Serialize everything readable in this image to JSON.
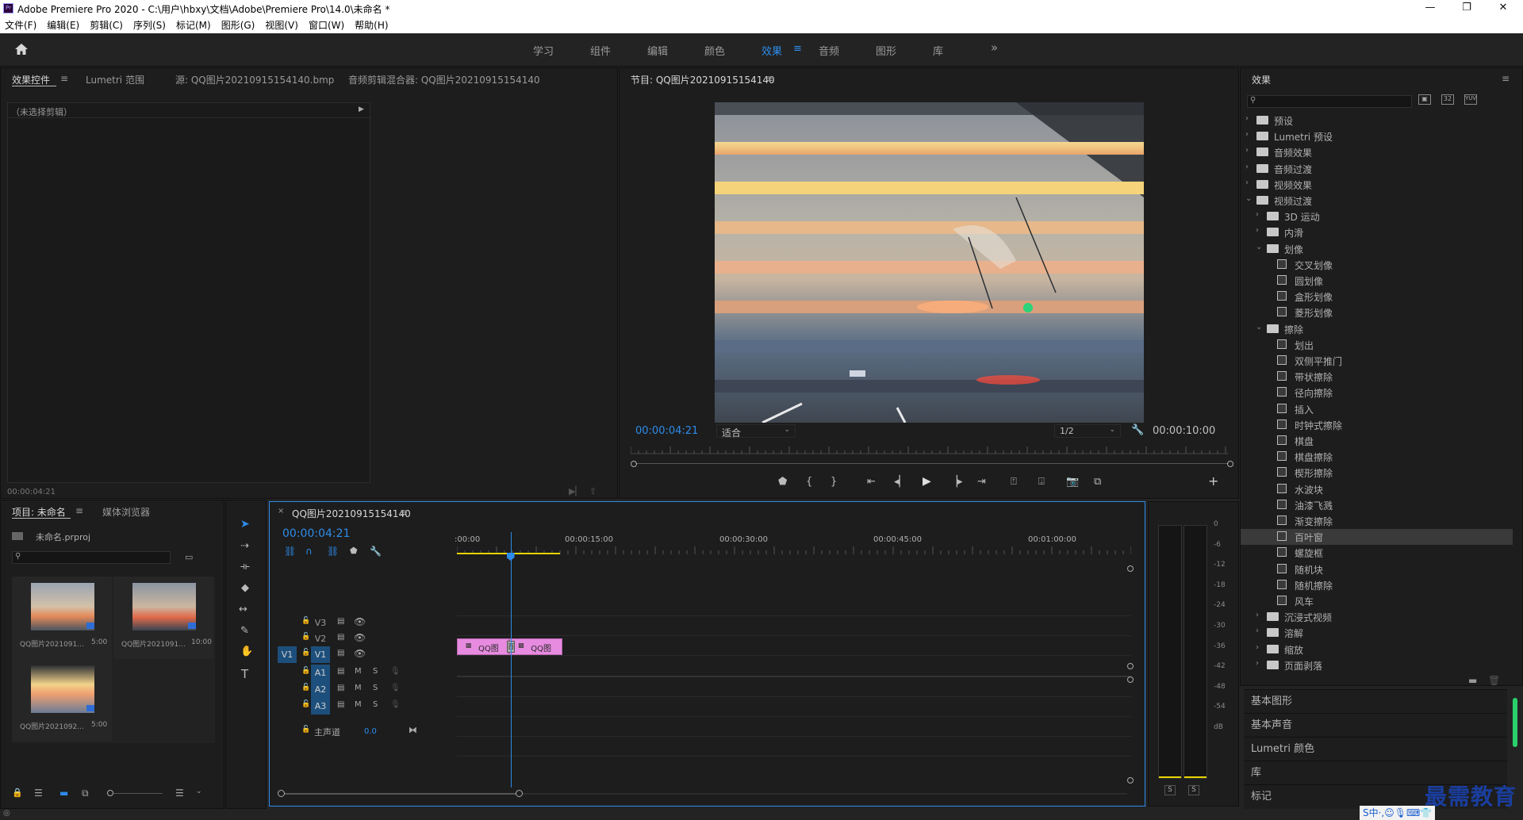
{
  "app": {
    "title": "Adobe Premiere Pro 2020 - C:\\用户\\hbxy\\文档\\Adobe\\Premiere Pro\\14.0\\未命名 *",
    "window_controls": [
      "—",
      "❐",
      "✕"
    ]
  },
  "menu": [
    "文件(F)",
    "编辑(E)",
    "剪辑(C)",
    "序列(S)",
    "标记(M)",
    "图形(G)",
    "视图(V)",
    "窗口(W)",
    "帮助(H)"
  ],
  "workspaces": [
    "学习",
    "组件",
    "编辑",
    "颜色",
    "效果",
    "音频",
    "图形",
    "库"
  ],
  "workspace_more": "»",
  "workspace_menu_icon": "≡",
  "source_panel": {
    "tabs": [
      "效果控件",
      "Lumetri 范围",
      "源: QQ图片20210915154140.bmp",
      "音频剪辑混合器: QQ图片20210915154140"
    ],
    "menu_icon": "≡",
    "no_clip": "（未选择剪辑）",
    "timecode": "00:00:04:21"
  },
  "program": {
    "title": "节目: QQ图片20210915154140",
    "menu_icon": "≡",
    "timecode": "00:00:04:21",
    "fit": "适合",
    "resolution": "1/2",
    "duration": "00:00:10:00",
    "playhead": 0.486
  },
  "effects_panel": {
    "title": "效果",
    "menu_icon": "≡",
    "search_placeholder": "",
    "items": [
      {
        "label": "预设",
        "level": 0,
        "type": "preset",
        "state": "collapsed"
      },
      {
        "label": "Lumetri 预设",
        "level": 0,
        "type": "preset",
        "state": "collapsed"
      },
      {
        "label": "音频效果",
        "level": 0,
        "type": "folder",
        "state": "collapsed"
      },
      {
        "label": "音频过渡",
        "level": 0,
        "type": "folder",
        "state": "collapsed"
      },
      {
        "label": "视频效果",
        "level": 0,
        "type": "folder",
        "state": "collapsed"
      },
      {
        "label": "视频过渡",
        "level": 0,
        "type": "folder",
        "state": "expanded"
      },
      {
        "label": "3D 运动",
        "level": 1,
        "type": "folder",
        "state": "collapsed"
      },
      {
        "label": "内滑",
        "level": 1,
        "type": "folder",
        "state": "collapsed"
      },
      {
        "label": "划像",
        "level": 1,
        "type": "folder",
        "state": "expanded"
      },
      {
        "label": "交叉划像",
        "level": 2,
        "type": "effect"
      },
      {
        "label": "圆划像",
        "level": 2,
        "type": "effect"
      },
      {
        "label": "盒形划像",
        "level": 2,
        "type": "effect"
      },
      {
        "label": "菱形划像",
        "level": 2,
        "type": "effect"
      },
      {
        "label": "擦除",
        "level": 1,
        "type": "folder",
        "state": "expanded"
      },
      {
        "label": "划出",
        "level": 2,
        "type": "effect"
      },
      {
        "label": "双侧平推门",
        "level": 2,
        "type": "effect"
      },
      {
        "label": "带状擦除",
        "level": 2,
        "type": "effect"
      },
      {
        "label": "径向擦除",
        "level": 2,
        "type": "effect"
      },
      {
        "label": "插入",
        "level": 2,
        "type": "effect"
      },
      {
        "label": "时钟式擦除",
        "level": 2,
        "type": "effect"
      },
      {
        "label": "棋盘",
        "level": 2,
        "type": "effect"
      },
      {
        "label": "棋盘擦除",
        "level": 2,
        "type": "effect"
      },
      {
        "label": "楔形擦除",
        "level": 2,
        "type": "effect"
      },
      {
        "label": "水波块",
        "level": 2,
        "type": "effect"
      },
      {
        "label": "油漆飞溅",
        "level": 2,
        "type": "effect"
      },
      {
        "label": "渐变擦除",
        "level": 2,
        "type": "effect"
      },
      {
        "label": "百叶窗",
        "level": 2,
        "type": "effect",
        "selected": true
      },
      {
        "label": "螺旋框",
        "level": 2,
        "type": "effect"
      },
      {
        "label": "随机块",
        "level": 2,
        "type": "effect"
      },
      {
        "label": "随机擦除",
        "level": 2,
        "type": "effect"
      },
      {
        "label": "风车",
        "level": 2,
        "type": "effect"
      },
      {
        "label": "沉浸式视频",
        "level": 1,
        "type": "folder",
        "state": "collapsed"
      },
      {
        "label": "溶解",
        "level": 1,
        "type": "folder",
        "state": "collapsed"
      },
      {
        "label": "缩放",
        "level": 1,
        "type": "folder",
        "state": "collapsed"
      },
      {
        "label": "页面剥落",
        "level": 1,
        "type": "folder",
        "state": "collapsed"
      }
    ],
    "subpanels": [
      "基本图形",
      "基本声音",
      "Lumetri 颜色",
      "库",
      "标记"
    ]
  },
  "project": {
    "tabs": [
      "项目: 未命名",
      "媒体浏览器"
    ],
    "menu_icon": "≡",
    "file": "未命名.prproj",
    "search_placeholder": "",
    "items": [
      {
        "name": "QQ图片2021091...",
        "duration": "5:00"
      },
      {
        "name": "QQ图片2021091...",
        "duration": "10:00"
      },
      {
        "name": "QQ图片2021092...",
        "duration": "5:00"
      }
    ]
  },
  "timeline": {
    "tab": "QQ图片20210915154140",
    "close_icon": "×",
    "menu_icon": "≡",
    "timecode": "00:00:04:21",
    "ruler": [
      ":00:00",
      "00:00:15:00",
      "00:00:30:00",
      "00:00:45:00",
      "00:01:00:00"
    ],
    "playhead": 0.0795,
    "tracks": [
      {
        "name": "V3",
        "kind": "video"
      },
      {
        "name": "V2",
        "kind": "video"
      },
      {
        "name": "V1",
        "kind": "video",
        "source": "V1"
      },
      {
        "name": "A1",
        "kind": "audio"
      },
      {
        "name": "A2",
        "kind": "audio"
      },
      {
        "name": "A3",
        "kind": "audio"
      }
    ],
    "master_label": "主声道",
    "master_value": "0.0",
    "mute_label": "M",
    "solo_label": "S",
    "clips": [
      {
        "label": "QQ图",
        "track": "V1",
        "start": 0.0,
        "end": 0.078
      },
      {
        "label": "QQ图",
        "track": "V1",
        "start": 0.078,
        "end": 0.157
      }
    ],
    "transition_label": "百"
  },
  "meter": {
    "scale": [
      "0",
      "-6",
      "-12",
      "-18",
      "-24",
      "-30",
      "-36",
      "-42",
      "-48",
      "-54",
      "dB"
    ],
    "solo": [
      "S",
      "S"
    ]
  },
  "watermark": {
    "text": "最需教育",
    "ime": "S中·,☺🎙⌨👕"
  },
  "colors": {
    "accent": "#2d8ceb",
    "clip": "#e78be0",
    "panel": "#1d1d1d",
    "bg": "#232323"
  }
}
